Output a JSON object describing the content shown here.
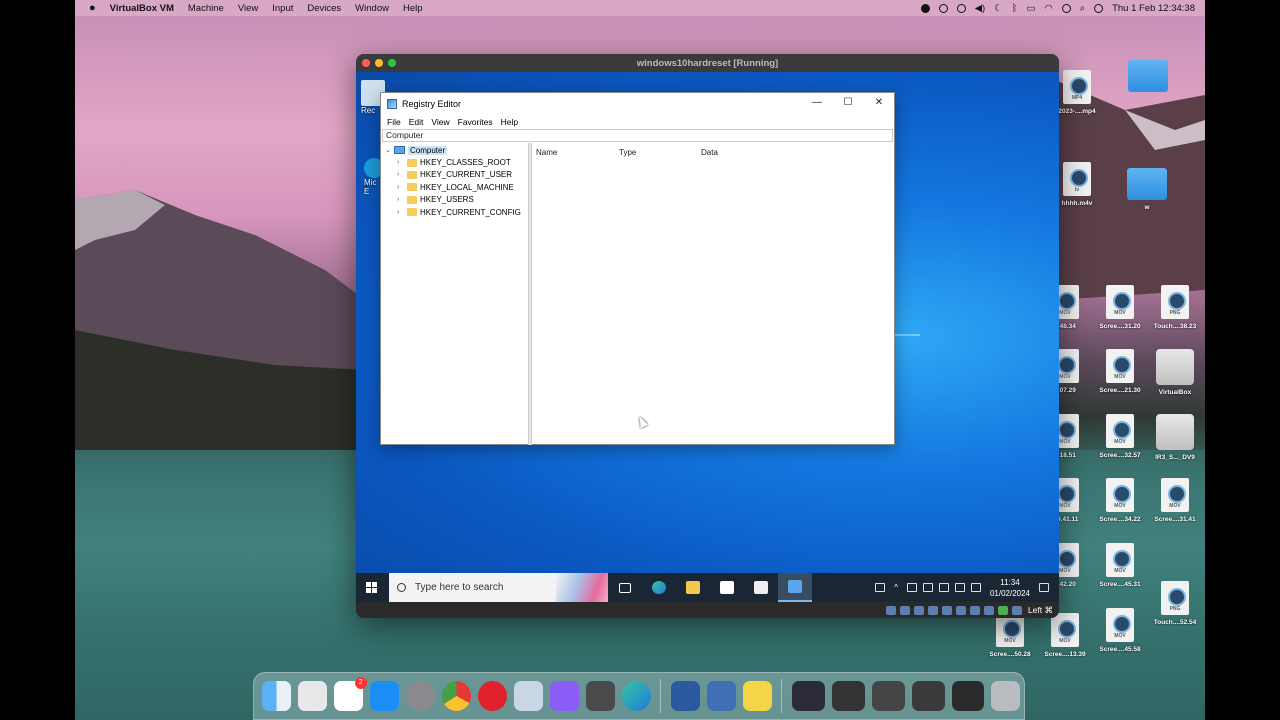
{
  "mac_menubar": {
    "app_name": "VirtualBox VM",
    "menus": [
      "Machine",
      "View",
      "Input",
      "Devices",
      "Window",
      "Help"
    ],
    "clock": "Thu 1 Feb  12:34:38"
  },
  "vbox_window": {
    "title": "windows10hardreset [Running]",
    "hostkey_label": "Left ⌘"
  },
  "regedit": {
    "title": "Registry Editor",
    "menus": [
      "File",
      "Edit",
      "View",
      "Favorites",
      "Help"
    ],
    "address": "Computer",
    "tree_root": "Computer",
    "hives": [
      "HKEY_CLASSES_ROOT",
      "HKEY_CURRENT_USER",
      "HKEY_LOCAL_MACHINE",
      "HKEY_USERS",
      "HKEY_CURRENT_CONFIG"
    ],
    "columns": [
      "Name",
      "Type",
      "Data"
    ],
    "win_controls": {
      "minimize": "—",
      "maximize": "☐",
      "close": "✕"
    }
  },
  "vm_desktop": {
    "icon_labels": [
      "Rec",
      "Mic",
      "E"
    ]
  },
  "taskbar": {
    "search_placeholder": "Type here to search",
    "time": "11:34",
    "date": "01/02/2024"
  },
  "desktop_icons": [
    {
      "label": "2023-....mp4",
      "ext": "MP4"
    },
    {
      "label": "hhhh.m4v",
      "ext": "tv"
    },
    {
      "label": "...48.34",
      "ext": "MOV"
    },
    {
      "label": "Scree....31.20",
      "ext": "MOV"
    },
    {
      "label": "Touch....38.23",
      "ext": "PNG"
    },
    {
      "label": "...07.29",
      "ext": "MOV"
    },
    {
      "label": "Scree....21.30",
      "ext": "MOV"
    },
    {
      "label": "VirtualBox",
      "ext": ""
    },
    {
      "label": "...18.51",
      "ext": "MOV"
    },
    {
      "label": "Scree....32.57",
      "ext": "MOV"
    },
    {
      "label": "IR3_S..._DV9",
      "ext": ""
    },
    {
      "label": "...9.41.11",
      "ext": "MOV"
    },
    {
      "label": "Scree....34.22",
      "ext": "MOV"
    },
    {
      "label": "Scree....31.41",
      "ext": "MOV"
    },
    {
      "label": "...42.20",
      "ext": "MOV"
    },
    {
      "label": "Scree....45.31",
      "ext": "MOV"
    },
    {
      "label": "Touch....52.54",
      "ext": "PNG"
    },
    {
      "label": "Scree....50.28",
      "ext": "MOV"
    },
    {
      "label": "Scree....13.39",
      "ext": "MOV"
    },
    {
      "label": "Scree....45.58",
      "ext": "MOV"
    },
    {
      "label": "w",
      "ext": ""
    }
  ],
  "dock": {
    "reminders_badge": "2",
    "app_names": [
      "Finder",
      "Launchpad",
      "Reminders",
      "App Store",
      "System Settings",
      "Chrome",
      "Opera",
      "Preview",
      "Feedback",
      "Calculator",
      "Edge",
      "VirtualBox",
      "VirtualBox VM",
      "Notes"
    ]
  }
}
